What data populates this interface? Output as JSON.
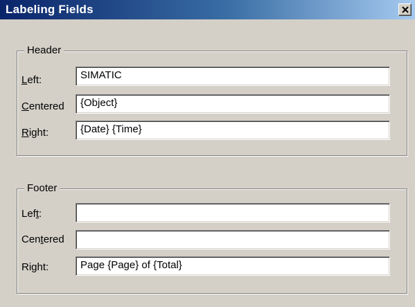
{
  "window": {
    "title": "Labeling Fields",
    "close_glyph": "close-icon"
  },
  "header_group": {
    "legend": "Header",
    "rows": [
      {
        "label_pre": "",
        "label_ul": "L",
        "label_post": "eft:",
        "value": "SIMATIC"
      },
      {
        "label_pre": "",
        "label_ul": "C",
        "label_post": "entered",
        "value": "{Object}"
      },
      {
        "label_pre": "",
        "label_ul": "R",
        "label_post": "ight:",
        "value": "{Date} {Time}"
      }
    ]
  },
  "footer_group": {
    "legend": "Footer",
    "rows": [
      {
        "label_pre": "Lef",
        "label_ul": "t",
        "label_post": ":",
        "value": ""
      },
      {
        "label_pre": "Cen",
        "label_ul": "t",
        "label_post": "ered",
        "value": ""
      },
      {
        "label_pre": "Ri",
        "label_ul": "g",
        "label_post": "ht:",
        "value": "Page {Page} of {Total}"
      }
    ]
  },
  "colors": {
    "face": "#d4d0c8",
    "titlebar_start": "#0a246a",
    "titlebar_end": "#a6caf0"
  }
}
